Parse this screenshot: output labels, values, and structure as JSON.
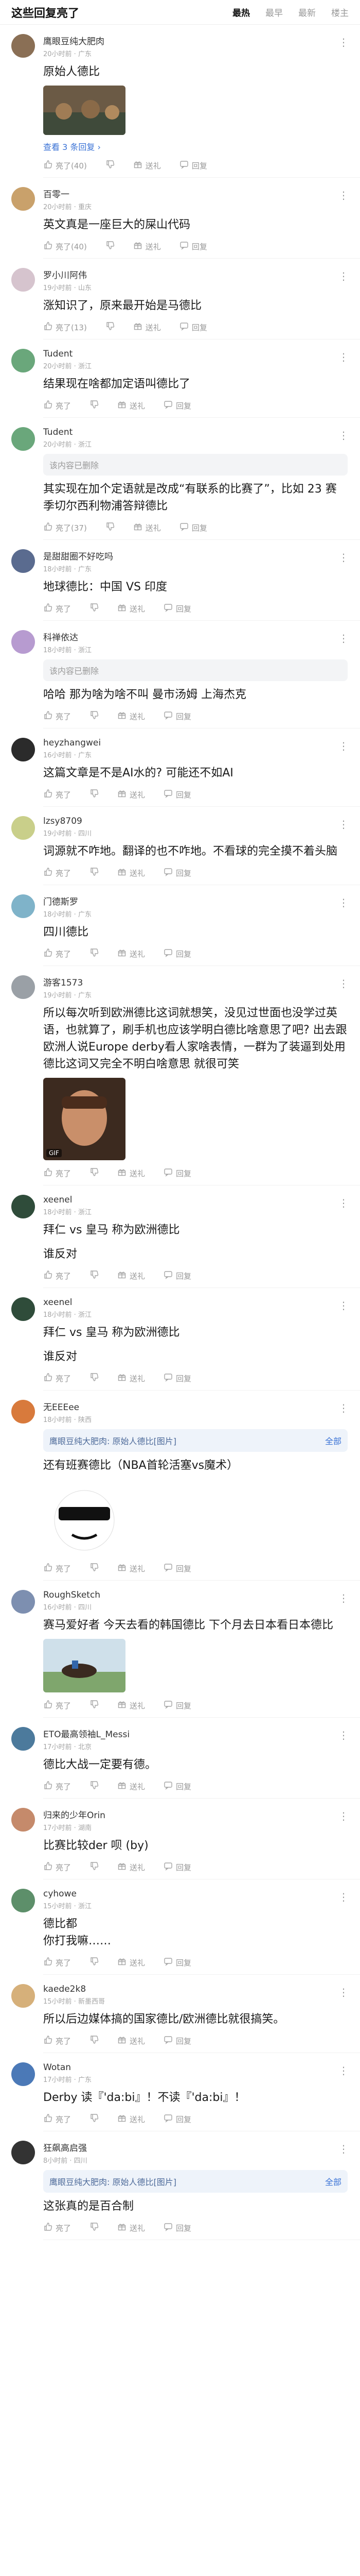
{
  "header": {
    "title": "这些回复亮了",
    "tabs": [
      "最热",
      "最早",
      "最新",
      "楼主"
    ]
  },
  "labels": {
    "gift": "送礼",
    "reply": "回复",
    "view_all": "全部",
    "gif": "GIF"
  },
  "comments": [
    {
      "user": "鹰眼豆纯大肥肉",
      "meta": "20小时前 · 广东",
      "text": "原始人德比",
      "likes": "亮了(40)",
      "replies_label": "查看 3 条回复 ›",
      "has_image": true,
      "image_kind": "photo"
    },
    {
      "user": "百零一",
      "meta": "20小时前 · 重庆",
      "text": "英文真是一座巨大的屎山代码",
      "likes": "亮了(40)"
    },
    {
      "user": "罗小川阿伟",
      "meta": "19小时前 · 山东",
      "text": "涨知识了，原来最开始是马德比",
      "likes": "亮了(13)"
    },
    {
      "user": "Tudent",
      "meta": "20小时前 · 浙江",
      "text": "结果现在啥都加定语叫德比了",
      "likes": "亮了"
    },
    {
      "user": "Tudent",
      "meta": "20小时前 · 浙江",
      "deleted": "该内容已删除",
      "text": "其实现在加个定语就是改成“有联系的比赛了”，比如 23 赛季切尔西利物浦答辩德比",
      "likes": "亮了(37)"
    },
    {
      "user": "是甜甜圈不好吃吗",
      "meta": "18小时前 · 广东",
      "text": "地球德比：中国 VS 印度",
      "likes": "亮了"
    },
    {
      "user": "科禅依达",
      "meta": "18小时前 · 浙江",
      "deleted": "该内容已删除",
      "text": "哈哈 那为啥为啥不叫 曼市汤姆 上海杰克",
      "likes": "亮了"
    },
    {
      "user": "heyzhangwei",
      "meta": "16小时前 · 广东",
      "text": "这篇文章是不是AI水的? 可能还不如AI",
      "likes": "亮了"
    },
    {
      "user": "lzsy8709",
      "meta": "19小时前 · 四川",
      "text": "词源就不咋地。翻译的也不咋地。不看球的完全摸不着头脑",
      "likes": "亮了"
    },
    {
      "user": "门德斯罗",
      "meta": "18小时前 · 广东",
      "text": "四川德比",
      "likes": "亮了"
    },
    {
      "user": "游客1573",
      "meta": "19小时前 · 广东",
      "text": "所以每次听到欧洲德比这词就想笑，没见过世面也没学过英语，也就算了，刷手机也应该学明白德比啥意思了吧? 出去跟欧洲人说Europe derby看人家啥表情，一群为了装逼到处用德比这词又完全不明白啥意思 就很可笑",
      "likes": "亮了",
      "has_image": true,
      "image_kind": "gif"
    },
    {
      "user": "xeenel",
      "meta": "18小时前 · 浙江",
      "text": "拜仁 vs 皇马 称为欧洲德比",
      "subtext": "谁反对",
      "likes": "亮了"
    },
    {
      "user": "xeenel",
      "meta": "18小时前 · 浙江",
      "text": "拜仁 vs 皇马 称为欧洲德比",
      "subtext": "谁反对",
      "likes": "亮了"
    },
    {
      "user": "无EEEee",
      "meta": "18小时前 · 陕西",
      "quote": "鹰眼豆纯大肥肉: 原始人德比[图片]",
      "text": "还有班赛德比（NBA首轮活塞vs魔术）",
      "likes": "亮了",
      "has_image": true,
      "image_kind": "meme"
    },
    {
      "user": "RoughSketch",
      "meta": "16小时前 · 四川",
      "text": "赛马爱好者 今天去看的韩国德比 下个月去日本看日本德比",
      "likes": "亮了",
      "has_image": true,
      "image_kind": "horse"
    },
    {
      "user": "ETO最高领袖L_Messi",
      "meta": "17小时前 · 北京",
      "text": "德比大战一定要有德。",
      "likes": "亮了"
    },
    {
      "user": "归来的少年Orin",
      "meta": "17小时前 · 湖南",
      "text": "比赛比较der 呗 (by)",
      "likes": "亮了"
    },
    {
      "user": "cyhowe",
      "meta": "15小时前 · 浙江",
      "text": "德比都\n你打我嘛……",
      "likes": "亮了"
    },
    {
      "user": "kaede2k8",
      "meta": "15小时前 · 新墨西哥",
      "text": "所以后边媒体搞的国家德比/欧洲德比就很搞笑。",
      "likes": "亮了"
    },
    {
      "user": "Wotan",
      "meta": "17小时前 · 广东",
      "text": "Derby 读『'da:bi』！不读『'da:bi』！",
      "likes": "亮了"
    },
    {
      "user": "狂飙高启强",
      "meta": "8小时前 · 四川",
      "quote": "鹰眼豆纯大肥肉: 原始人德比[图片]",
      "text": "这张真的是百合制",
      "likes": "亮了"
    }
  ]
}
